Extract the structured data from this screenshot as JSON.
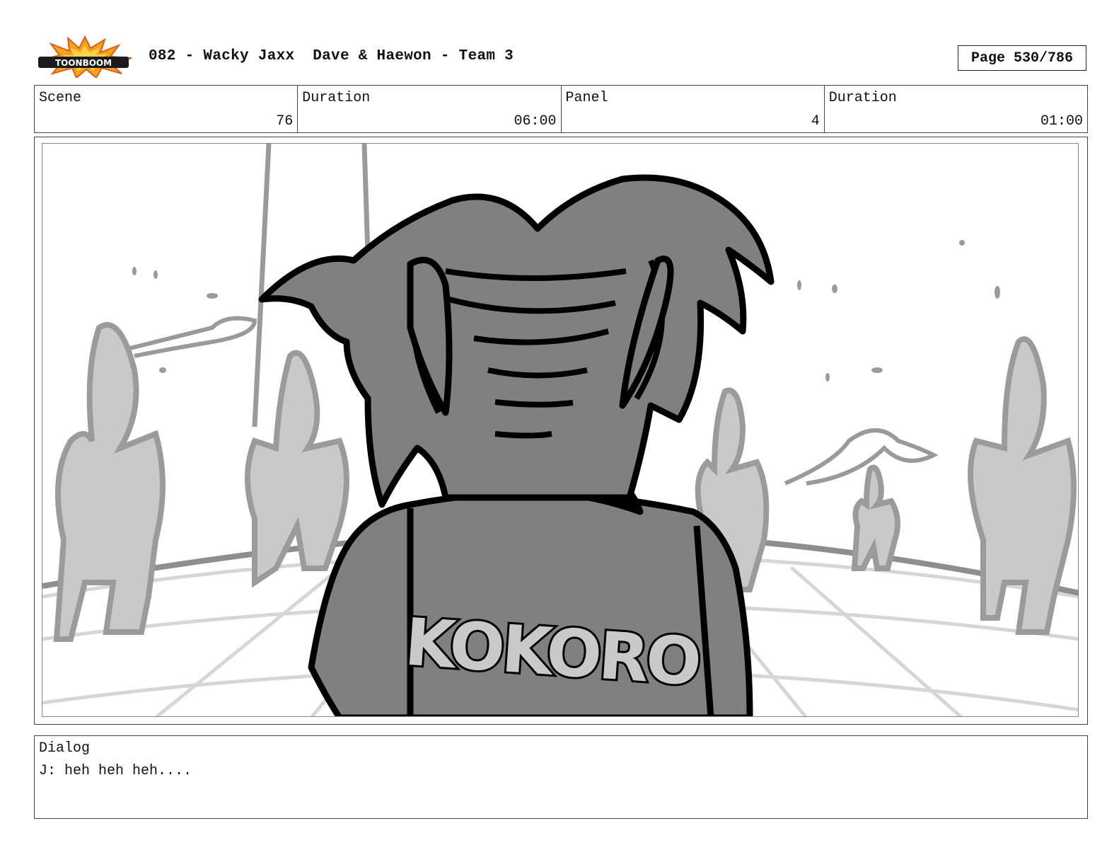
{
  "header": {
    "logo_text": "TOONBOOM",
    "title": "082 - Wacky Jaxx  Dave & Haewon - Team 3",
    "page_label": "Page 530/786"
  },
  "info": {
    "scene_label": "Scene",
    "scene_value": "76",
    "scene_duration_label": "Duration",
    "scene_duration_value": "06:00",
    "panel_label": "Panel",
    "panel_value": "4",
    "panel_duration_label": "Duration",
    "panel_duration_value": "01:00"
  },
  "panel": {
    "shirt_text": "KOKORO"
  },
  "dialog": {
    "label": "Dialog",
    "text": "J: heh heh heh...."
  }
}
